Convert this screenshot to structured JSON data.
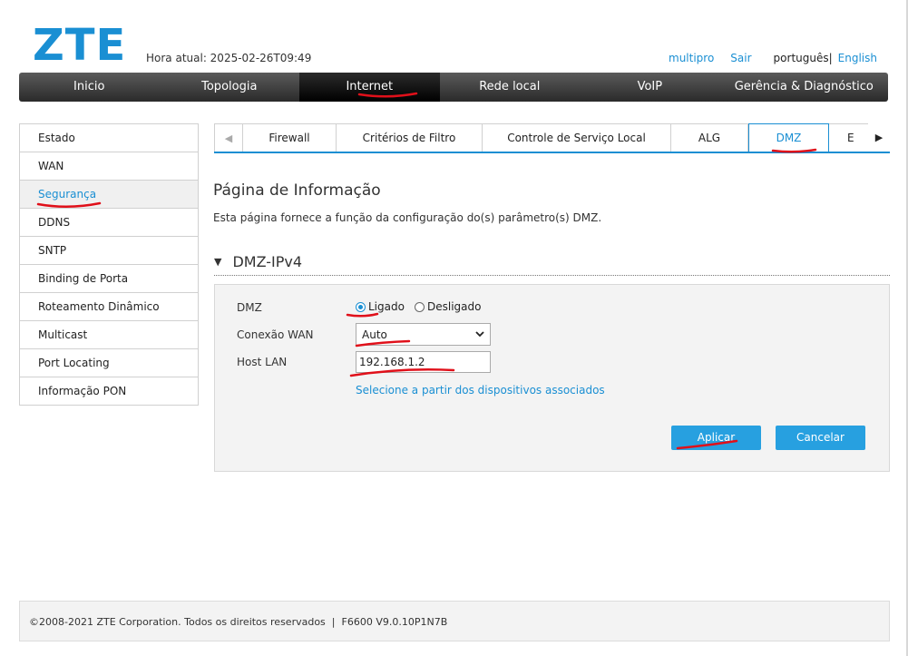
{
  "brand": {
    "logo": "ZTE"
  },
  "header": {
    "time_label": "Hora atual: 2025-02-26T09:49",
    "user": "multipro",
    "logout": "Sair",
    "lang_current": "português|",
    "lang_other": "English"
  },
  "nav": {
    "items": [
      {
        "label": "Inicio"
      },
      {
        "label": "Topologia"
      },
      {
        "label": "Internet"
      },
      {
        "label": "Rede local"
      },
      {
        "label": "VoIP"
      },
      {
        "label": "Gerência & Diagnóstico"
      }
    ],
    "active": "Internet"
  },
  "sidebar": {
    "items": [
      {
        "label": "Estado"
      },
      {
        "label": "WAN"
      },
      {
        "label": "Segurança"
      },
      {
        "label": "DDNS"
      },
      {
        "label": "SNTP"
      },
      {
        "label": "Binding de Porta"
      },
      {
        "label": "Roteamento Dinâmico"
      },
      {
        "label": "Multicast"
      },
      {
        "label": "Port Locating"
      },
      {
        "label": "Informação PON"
      }
    ],
    "active": "Segurança"
  },
  "tabs": {
    "items": [
      {
        "label": "Firewall"
      },
      {
        "label": "Critérios de Filtro"
      },
      {
        "label": "Controle de Serviço Local"
      },
      {
        "label": "ALG"
      },
      {
        "label": "DMZ"
      },
      {
        "label": "E"
      }
    ],
    "active": "DMZ"
  },
  "page": {
    "title": "Página de Informação",
    "description": "Esta página fornece a função da configuração do(s) parâmetro(s) DMZ.",
    "section_title": "DMZ-IPv4"
  },
  "form": {
    "dmz_label": "DMZ",
    "dmz_on": "Ligado",
    "dmz_off": "Desligado",
    "dmz_selected": "Ligado",
    "wan_label": "Conexão WAN",
    "wan_value": "Auto",
    "host_label": "Host LAN",
    "host_value": "192.168.1.2",
    "select_link": "Selecione a partir dos dispositivos associados",
    "apply": "Aplicar",
    "cancel": "Cancelar"
  },
  "footer": {
    "copyright": "©2008-2021 ZTE Corporation. Todos os direitos reservados",
    "separator": "|",
    "version": "F6600 V9.0.10P1N7B"
  },
  "colors": {
    "accent": "#1a8fd3",
    "button": "#27a0e0",
    "annotation": "#e0101a"
  }
}
